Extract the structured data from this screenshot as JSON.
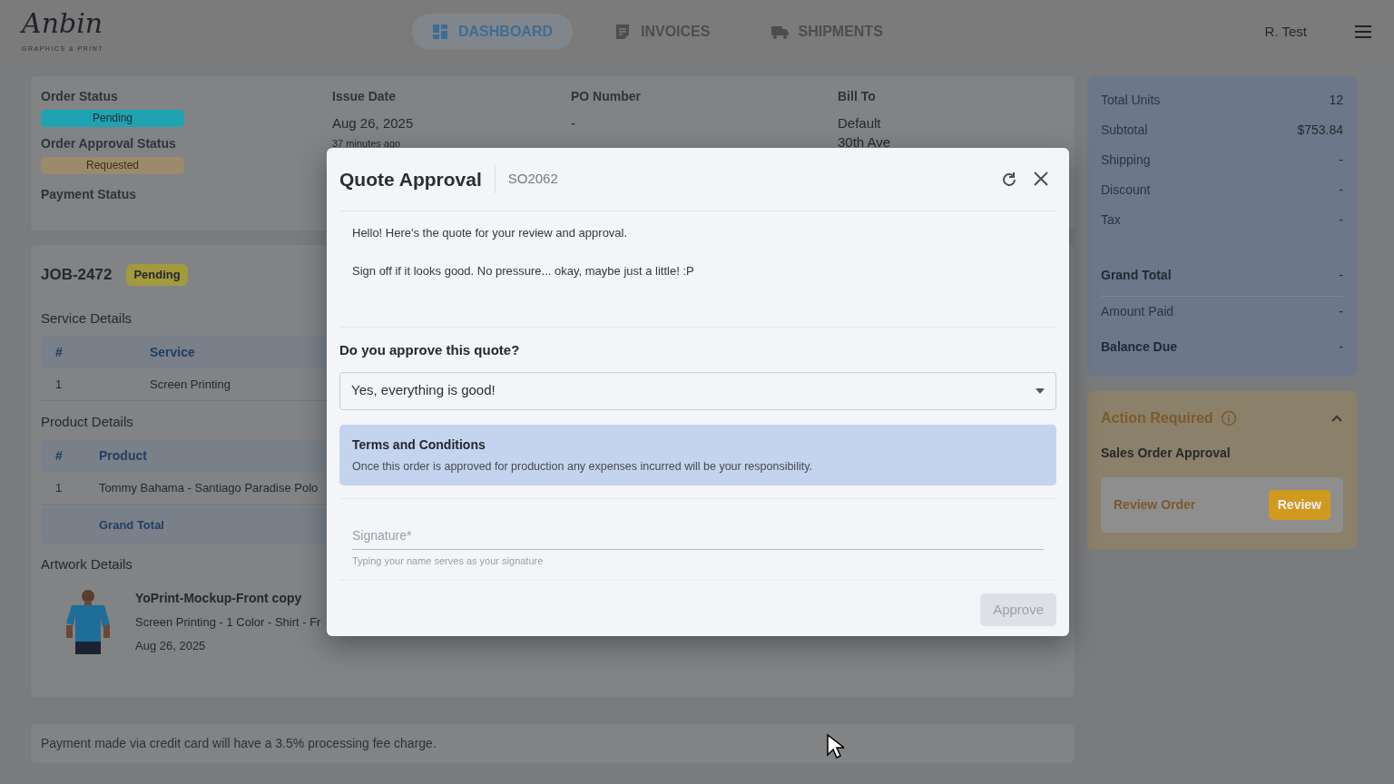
{
  "nav": {
    "logo": "Anbin",
    "logo_tagline": "GRAPHICS & PRINT",
    "user": "R. Test",
    "tabs": [
      {
        "label": "DASHBOARD",
        "selected": true
      },
      {
        "label": "INVOICES",
        "selected": false
      },
      {
        "label": "SHIPMENTS",
        "selected": false
      }
    ]
  },
  "order_info": {
    "status_fields": [
      {
        "label": "Order Status",
        "badge": "Pending",
        "color": "#1fa3b3"
      },
      {
        "label": "Order Approval Status",
        "badge": "Requested",
        "color": "#9c8a6c"
      },
      {
        "label": "Payment Status"
      }
    ],
    "columns": [
      {
        "label": "Issue Date",
        "lines": [
          "Aug 26, 2025"
        ],
        "note": "37 minutes ago"
      },
      {
        "label": "PO Number",
        "lines": [
          "-"
        ]
      },
      {
        "label": "Bill To",
        "lines": [
          "Default",
          "30th Ave"
        ]
      }
    ]
  },
  "job": {
    "title": "JOB-2472",
    "badge": "Pending",
    "tables": [
      {
        "title": "Service Details",
        "columns": [
          "#",
          "Service"
        ],
        "rows": [
          [
            "1",
            "Screen Printing"
          ]
        ]
      },
      {
        "title": "Product Details",
        "columns": [
          "#",
          "Product"
        ],
        "rows": [
          [
            "1",
            "Tommy Bahama - Santiago Paradise Polo"
          ]
        ],
        "footer": "Grand Total"
      }
    ],
    "artwork": {
      "title": "Artwork Details",
      "name": "YoPrint-Mockup-Front copy",
      "description": "Screen Printing - 1 Color - Shirt - Fr",
      "date": "Aug 26, 2025"
    }
  },
  "footer_note": "Payment made via credit card will have a 3.5% processing fee charge.",
  "totals": [
    {
      "label": "Total Units",
      "value": "12",
      "bold": false
    },
    {
      "label": "Subtotal",
      "value": "$753.84",
      "bold": false
    },
    {
      "label": "Shipping",
      "value": "-",
      "bold": false
    },
    {
      "label": "Discount",
      "value": "-",
      "bold": false
    },
    {
      "label": "Tax",
      "value": "-",
      "bold": false
    },
    {
      "label": "Grand Total",
      "value": "-",
      "bold": true
    },
    {
      "label": "Amount Paid",
      "value": "-",
      "bold": false
    },
    {
      "label": "Balance Due",
      "value": "-",
      "bold": true
    }
  ],
  "action": {
    "title": "Action Required",
    "expanded": true,
    "subtitle": "Sales Order Approval",
    "item": "Review Order",
    "button": "Review"
  },
  "modal": {
    "title": "Quote Approval",
    "order_number": "SO2062",
    "message": [
      "Hello! Here's the quote for your review and approval.",
      "Sign off if it looks good. No pressure... okay, maybe just a little! :P"
    ],
    "question": "Do you approve this quote?",
    "answer": "Yes, everything is good!",
    "terms_title": "Terms and Conditions",
    "terms_text": "Once this order is approved for production any expenses incurred will be your responsibility.",
    "signature_placeholder": "Signature*",
    "signature_help": "Typing your name serves as your signature",
    "approve": {
      "label": "Approve",
      "disabled": true
    }
  }
}
